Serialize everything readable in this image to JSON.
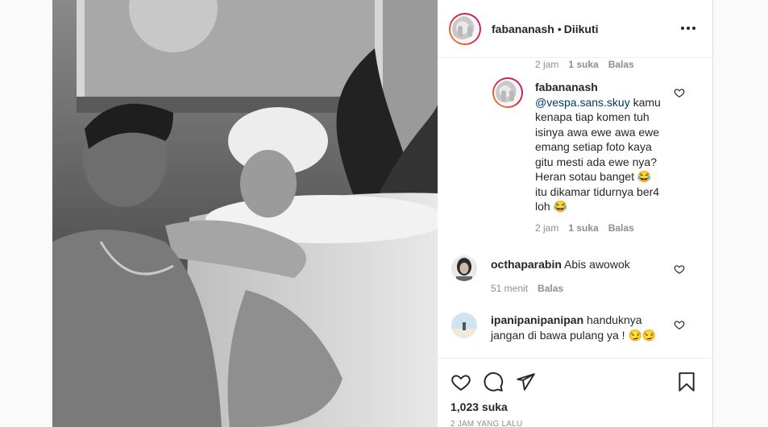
{
  "post": {
    "username": "fabananash",
    "dot": "•",
    "follow_status": "Diikuti"
  },
  "comments": {
    "first_meta": {
      "time": "2 jam",
      "likes": "1 suka",
      "reply": "Balas"
    },
    "reply_comment": {
      "username": "fabananash",
      "mention": "@vespa.sans.skuy",
      "lines": [
        " kamu",
        "kenapa tiap komen tuh",
        "isinya awa ewe awa ewe",
        "emang setiap foto kaya",
        "gitu mesti ada ewe nya?",
        "Heran sotau banget 😂",
        "itu dikamar tidurnya ber4",
        "loh 😂"
      ],
      "time": "2 jam",
      "likes": "1 suka",
      "reply": "Balas"
    },
    "comment_ocha": {
      "username": "octhaparabin",
      "text": "Abis awowok",
      "time": "51 menit",
      "reply": "Balas"
    },
    "comment_ipan": {
      "username": "ipanipanipanipan",
      "text_line1": "handuknya",
      "text_line2": "jangan di bawa pulang ya ! 😏😏"
    }
  },
  "footer": {
    "likes": "1,023 suka",
    "time_ago": "2 JAM YANG LALU"
  },
  "icons": {
    "like": "heart-icon",
    "comment": "comment-icon",
    "share": "paper-plane-icon",
    "save": "bookmark-icon",
    "more": "more-options-icon"
  }
}
